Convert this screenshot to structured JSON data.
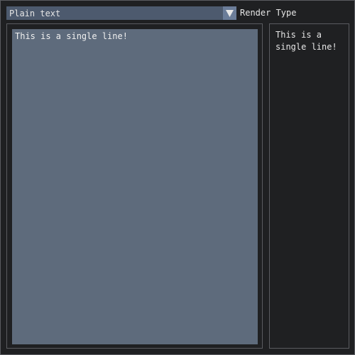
{
  "render_type": {
    "selected": "Plain text",
    "label": "Render Type"
  },
  "editor": {
    "text": "This is a single line!"
  },
  "preview": {
    "text": "This is a single line!"
  }
}
